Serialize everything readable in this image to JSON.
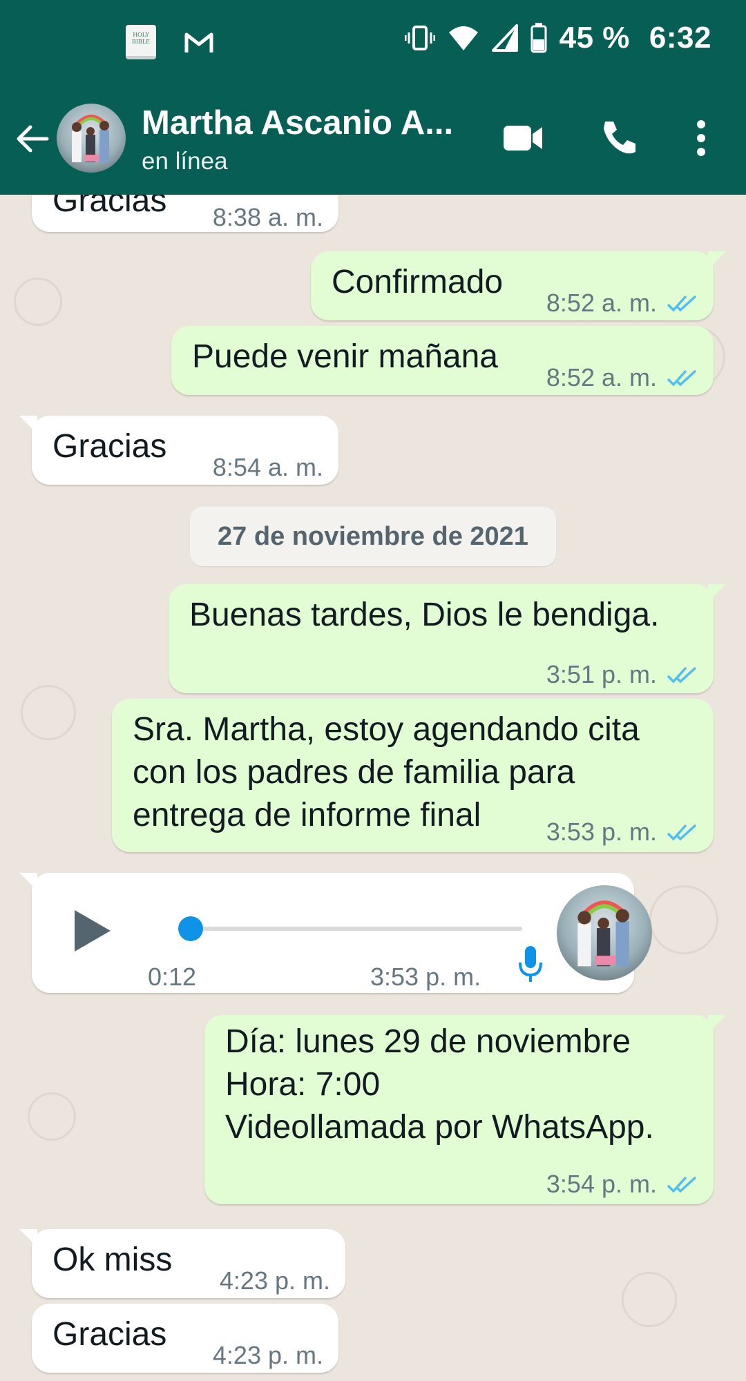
{
  "status_bar": {
    "notification_icons": [
      "holy-bible-app-icon",
      "gmail-icon"
    ],
    "bible_icon_text": "HOLY BIBLE",
    "system_icons": [
      "vibrate-icon",
      "wifi-icon",
      "cellular-signal-icon",
      "battery-icon"
    ],
    "battery": "45 %",
    "time": "6:32"
  },
  "header": {
    "contact_name": "Martha Ascanio A...",
    "status": "en línea",
    "actions": [
      "video-call-icon",
      "voice-call-icon",
      "more-options-icon"
    ]
  },
  "date_separator": "27 de noviembre de 2021",
  "messages": [
    {
      "direction": "in",
      "text": "Gracias",
      "time": "8:38 a. m."
    },
    {
      "direction": "out",
      "text": "Confirmado",
      "time": "8:52 a. m.",
      "ticks": "read"
    },
    {
      "direction": "out",
      "text": "Puede venir mañana",
      "time": "8:52 a. m.",
      "ticks": "read"
    },
    {
      "direction": "in",
      "text": "Gracias",
      "time": "8:54 a. m."
    },
    {
      "direction": "out",
      "text": "Buenas tardes, Dios le bendiga.",
      "time": "3:51 p. m.",
      "ticks": "read"
    },
    {
      "direction": "out",
      "text": "Sra. Martha, estoy agendando cita\ncon los padres de familia para\nentrega de informe final",
      "time": "3:53 p. m.",
      "ticks": "read"
    },
    {
      "direction": "in",
      "type": "voice",
      "duration": "0:12",
      "time": "3:53 p. m.",
      "progress": 0
    },
    {
      "direction": "out",
      "text": "Día: lunes 29 de noviembre\nHora: 7:00\nVideollamada por WhatsApp.",
      "time": "3:54 p. m.",
      "ticks": "read"
    },
    {
      "direction": "in",
      "text": "Ok miss",
      "time": "4:23 p. m."
    },
    {
      "direction": "in",
      "text": "Gracias",
      "time": "4:23 p. m."
    }
  ],
  "colors": {
    "header_bg": "#075e54",
    "chat_bg": "#ece5dd",
    "outgoing_bubble": "#e2fdd3",
    "incoming_bubble": "#ffffff",
    "read_ticks": "#53bdeb",
    "voice_progress": "#0e93e6"
  }
}
